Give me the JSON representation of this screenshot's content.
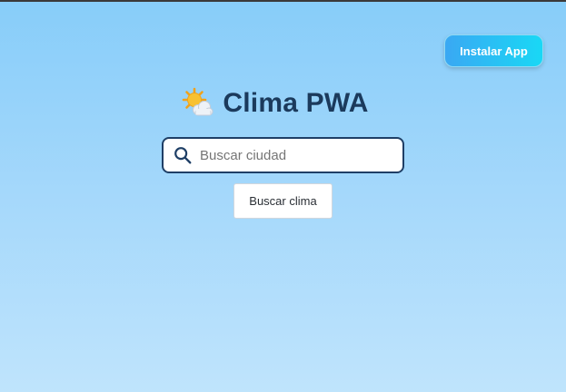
{
  "header": {
    "logo_icon": "sun-behind-cloud-icon",
    "title": "Clima PWA"
  },
  "install": {
    "label": "Instalar App",
    "gradient_from": "#3aa8f3",
    "gradient_to": "#19d8f5"
  },
  "search": {
    "icon": "search-icon",
    "placeholder": "Buscar ciudad",
    "value": "",
    "button_label": "Buscar clima"
  },
  "colors": {
    "title": "#1b3a5c",
    "input_border": "#1f3f66",
    "background_top": "#87cdf9",
    "background_bottom": "#bfe4fc"
  }
}
